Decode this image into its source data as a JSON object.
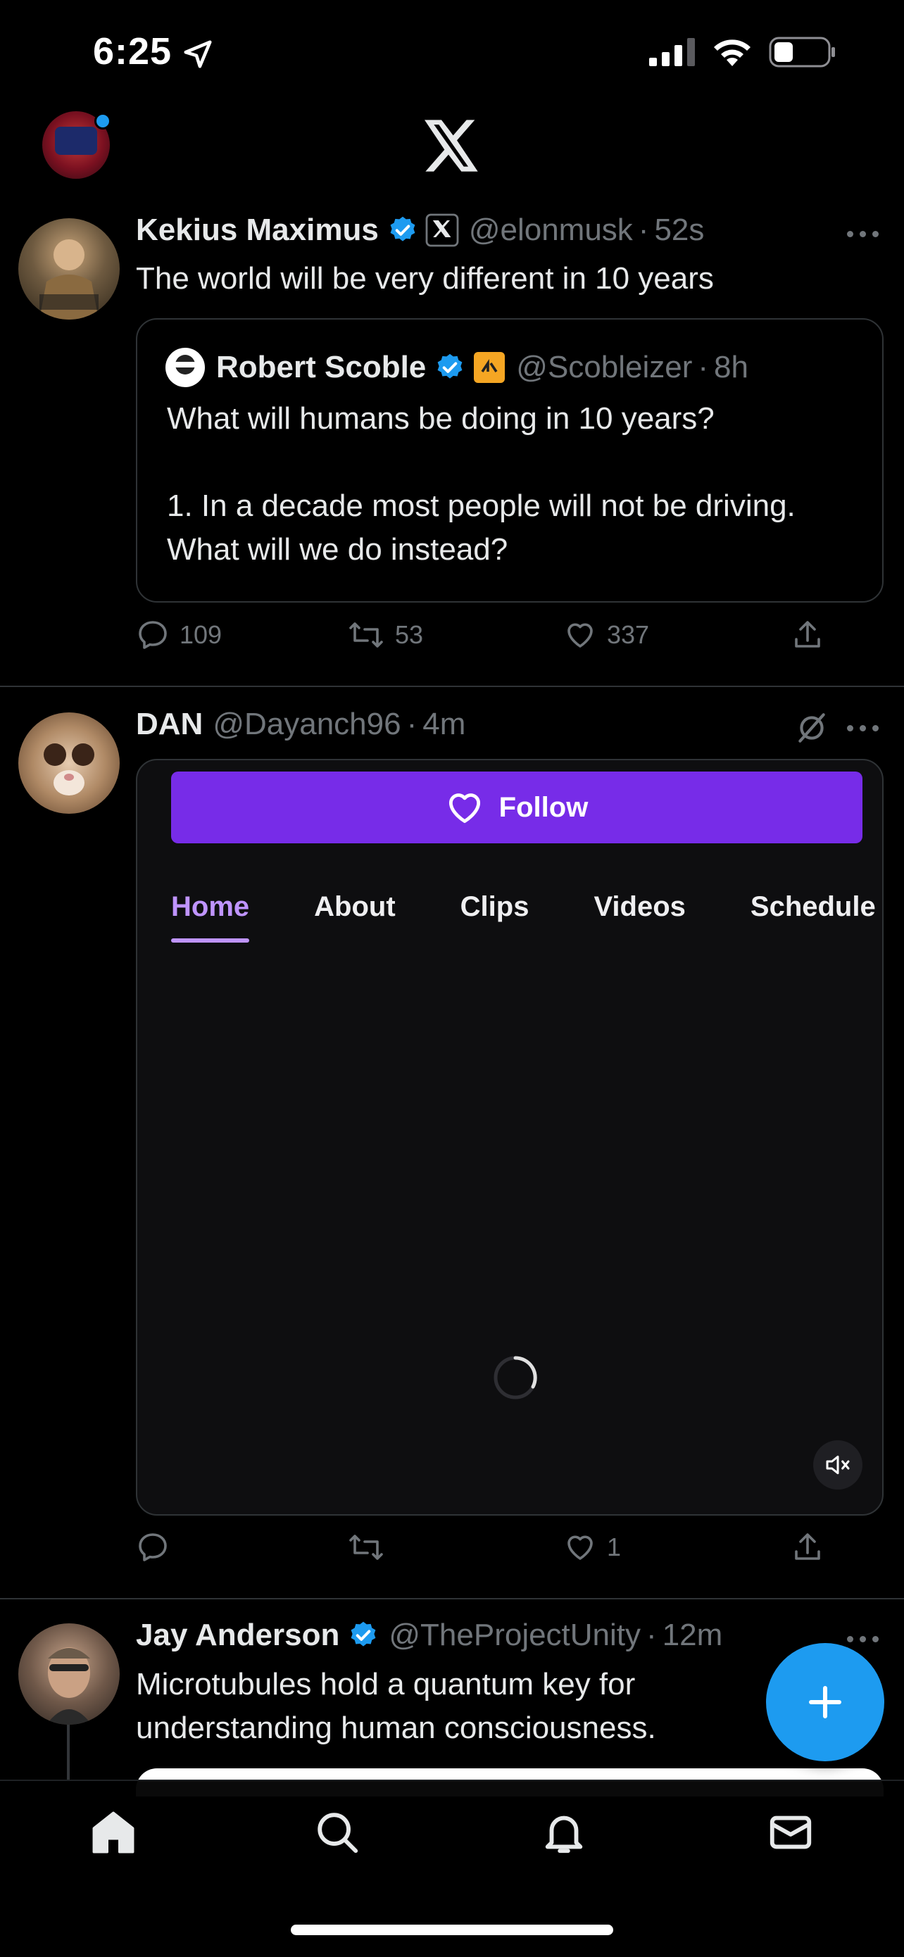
{
  "status_bar": {
    "time": "6:25",
    "colors": {
      "text": "#ffffff"
    }
  },
  "top_nav": {
    "avatar_badge_color": "#1d9bf0"
  },
  "tweets": [
    {
      "name": "Kekius Maximus",
      "handle": "@elonmusk",
      "dot": "·",
      "time": "52s",
      "text": "The world will be very different in 10 years",
      "quote": {
        "name": "Robert Scoble",
        "handle": "@Scobleizer",
        "dot": "·",
        "time": "8h",
        "text_line1": "What will humans be doing in 10 years?",
        "text_line2": "1. In a decade most people will not be driving. What will we do instead?"
      },
      "replies": "109",
      "reposts": "53",
      "likes": "337"
    },
    {
      "name": "DAN",
      "handle": "@Dayanch96",
      "dot": "·",
      "time": "4m",
      "media": {
        "follow_label": "Follow",
        "tabs": [
          "Home",
          "About",
          "Clips",
          "Videos",
          "Schedule"
        ]
      },
      "replies": "",
      "reposts": "",
      "likes": "1"
    },
    {
      "name": "Jay Anderson",
      "handle": "@TheProjectUnity",
      "dot": "·",
      "time": "12m",
      "text": "Microtubules hold a quantum key for understanding human consciousness."
    }
  ],
  "bottom_nav": {
    "items": [
      "home-icon",
      "search-icon",
      "bell-icon",
      "mail-icon"
    ]
  },
  "colors": {
    "background": "#000000",
    "accent": "#1d9bf0",
    "twitch_purple": "#772ce8",
    "muted": "#71767b"
  }
}
